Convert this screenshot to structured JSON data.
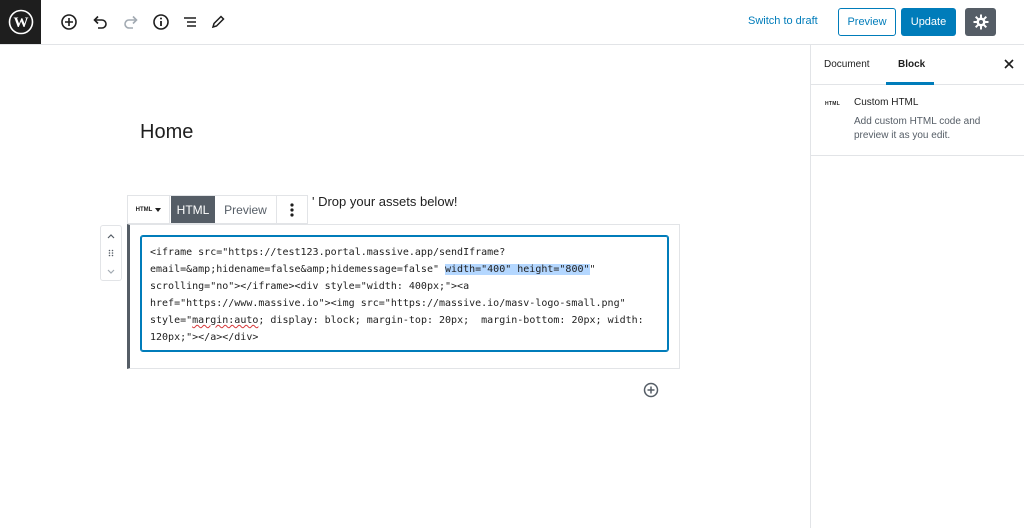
{
  "toolbar": {
    "switch_to_draft": "Switch to draft",
    "preview": "Preview",
    "update": "Update",
    "icons": [
      "wordpress-logo-icon",
      "add-block-icon",
      "undo-icon",
      "redo-icon",
      "info-icon",
      "outline-list-icon",
      "edit-pencil-icon",
      "settings-gear-icon"
    ]
  },
  "sidebar": {
    "tabs": [
      {
        "label": "Document",
        "active": false
      },
      {
        "label": "Block",
        "active": true
      }
    ],
    "block_icon_text": "HTML",
    "block_title": "Custom HTML",
    "block_description": "Add custom HTML code and preview it as you edit."
  },
  "editor": {
    "page_title": "Home",
    "paragraph_text": "' Drop your assets below!",
    "block_toolbar": {
      "type_label": "HTML",
      "html_tab": "HTML",
      "preview_tab": "Preview"
    },
    "code_lines": [
      "<iframe src=\"https://test123.portal.massive.app/sendIframe?",
      "email=&amp;hidename=false&amp;hidemessage=false\" ",
      "width=\"400\" height=\"800\"",
      "\"",
      "scrolling=\"no\"></iframe><div style=\"width: 400px;\"><a",
      "href=\"https://www.massive.io\"><img src=\"https://massive.io/masv-logo-small.png\"",
      "style=\"",
      "margin:auto",
      "; display: block; margin-top: 20px;  margin-bottom: 20px; width:",
      "120px;\"></a></div>"
    ]
  },
  "colors": {
    "accent": "#007cba",
    "dark": "#1e1e1e",
    "toolbar_gray": "#555d66",
    "selection": "#b4d7ff"
  }
}
